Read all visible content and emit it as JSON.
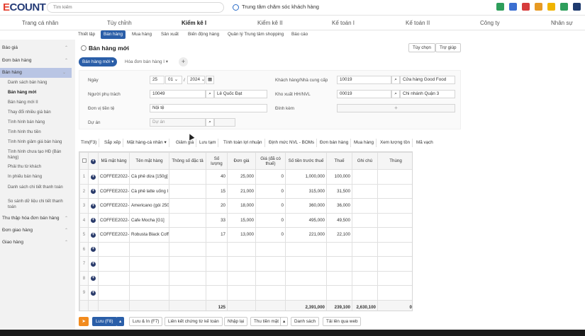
{
  "app": {
    "logo_main": "ECOUNT",
    "search_placeholder": "Tìm kiếm",
    "support_label": "Trung tâm chăm sóc khách hàng"
  },
  "topnav": [
    "Trang cá nhân",
    "Tùy chỉnh",
    "Kiểm kê I",
    "Kiểm kê II",
    "Kế toán I",
    "Kế toán II",
    "Công ty",
    "Nhân sự"
  ],
  "subnav": [
    "Thiết lập",
    "Bán hàng",
    "Mua hàng",
    "Sản xuất",
    "Biến động hàng",
    "Quản lý Trung tâm shopping",
    "Báo cáo"
  ],
  "sidebar": {
    "groups": [
      "Báo giá",
      "Đơn bán hàng",
      "Bán hàng"
    ],
    "items": [
      "Danh sách bán hàng",
      "Bán hàng mới",
      "Bán hàng mới II",
      "Thay đổi nhiều giá bán",
      "Tình hình bán hàng",
      "Tình hình thu tiền",
      "Tình hình giảm giá bán hàng",
      "Tình hình chưa tạo HĐ (Bán hàng)",
      "Phải thu từ khách",
      "In phiếu bán hàng",
      "Danh sách chi tiết thanh toán",
      "So sánh dữ liệu chi tiết thanh toán"
    ],
    "groups_after": [
      "Thu thập hóa đơn bán hàng",
      "Đơn giao hàng",
      "Giao hàng"
    ]
  },
  "page": {
    "title": "Bán hàng mới",
    "btn_options": "Tùy chọn",
    "btn_help": "Trợ giúp"
  },
  "tabs": {
    "active": "Bán hàng mới ▾",
    "inactive": "Hóa đơn bán hàng I ▾",
    "add": "+"
  },
  "form": {
    "date_label": "Ngày",
    "date_day": "25",
    "date_month": "01 ⌄",
    "date_sep": "/",
    "date_year": "2024 ⌄",
    "person_label": "Người phụ trách",
    "person_code": "10049",
    "person_name": "Lê Quốc Đạt",
    "currency_label": "Đơn vị tiền tệ",
    "currency_value": "Nội tệ",
    "project_label": "Dự án",
    "project_placeholder": "Dự án",
    "customer_label": "Khách hàng/Nhà cung cấp",
    "customer_code": "10019",
    "customer_name": "Cửa hàng Good Food",
    "warehouse_label": "Kho xuất HH/NVL",
    "warehouse_code": "00019",
    "warehouse_name": "Chi nhánh Quận 3",
    "attach_label": "Đính kèm",
    "attach_plus": "+"
  },
  "toolbar": [
    "Tìm(F3)",
    "Sắp xếp",
    "Mặt hàng-cá nhân ▾",
    "Giảm giá",
    "Lưu tạm",
    "Tính toán lợi nhuận",
    "Định mức NVL - BOMs",
    "Đơn bán hàng",
    "Mua hàng",
    "Xem lượng tồn",
    "Mã vạch"
  ],
  "table": {
    "headers": [
      "",
      "⊕",
      "Mã mặt hàng",
      "Tên mặt hàng",
      "Thông số đặc tả",
      "Số lượng",
      "Đơn giá",
      "Giá (đã có thuế)",
      "Số tiền trước thuế",
      "Thuế",
      "Ghi chú",
      "Thùng"
    ],
    "rows": [
      [
        "1",
        "COFFEE2022-",
        "Cà phê dừa [150g]",
        "",
        "40",
        "25,000",
        "0",
        "1,000,000",
        "100,000",
        "",
        ""
      ],
      [
        "2",
        "COFFEE2022-",
        "Cà phê latte uống l",
        "",
        "15",
        "21,000",
        "0",
        "315,000",
        "31,500",
        "",
        ""
      ],
      [
        "3",
        "COFFEE2022-",
        "Americano (gói 250",
        "",
        "20",
        "18,000",
        "0",
        "360,000",
        "36,000",
        "",
        ""
      ],
      [
        "4",
        "COFFEE2022-",
        "Cafe Mocha [G1]",
        "",
        "33",
        "15,000",
        "0",
        "495,000",
        "49,500",
        "",
        ""
      ],
      [
        "5",
        "COFFEE2022-",
        "Robusta Black Coff",
        "",
        "17",
        "13,000",
        "0",
        "221,000",
        "22,100",
        "",
        ""
      ],
      [
        "6",
        "",
        "",
        "",
        "",
        "",
        "",
        "",
        "",
        "",
        ""
      ],
      [
        "7",
        "",
        "",
        "",
        "",
        "",
        "",
        "",
        "",
        "",
        ""
      ],
      [
        "8",
        "",
        "",
        "",
        "",
        "",
        "",
        "",
        "",
        "",
        ""
      ],
      [
        "9",
        "",
        "",
        "",
        "",
        "",
        "",
        "",
        "",
        "",
        ""
      ]
    ],
    "totals": {
      "qty": "125",
      "pretax": "2,391,000",
      "tax": "239,100",
      "note": "2,630,100",
      "box": "0"
    }
  },
  "bottom": {
    "save": "Lưu (F8)",
    "save_arrow": "▴",
    "save_print": "Lưu & In (F7)",
    "link": "Liên kết chứng từ kế toán",
    "reenter": "Nhập lại",
    "collect": "Thu tiền mặt",
    "collect_arrow": "▴",
    "list": "Danh sách",
    "upload": "Tải lên qua web"
  }
}
